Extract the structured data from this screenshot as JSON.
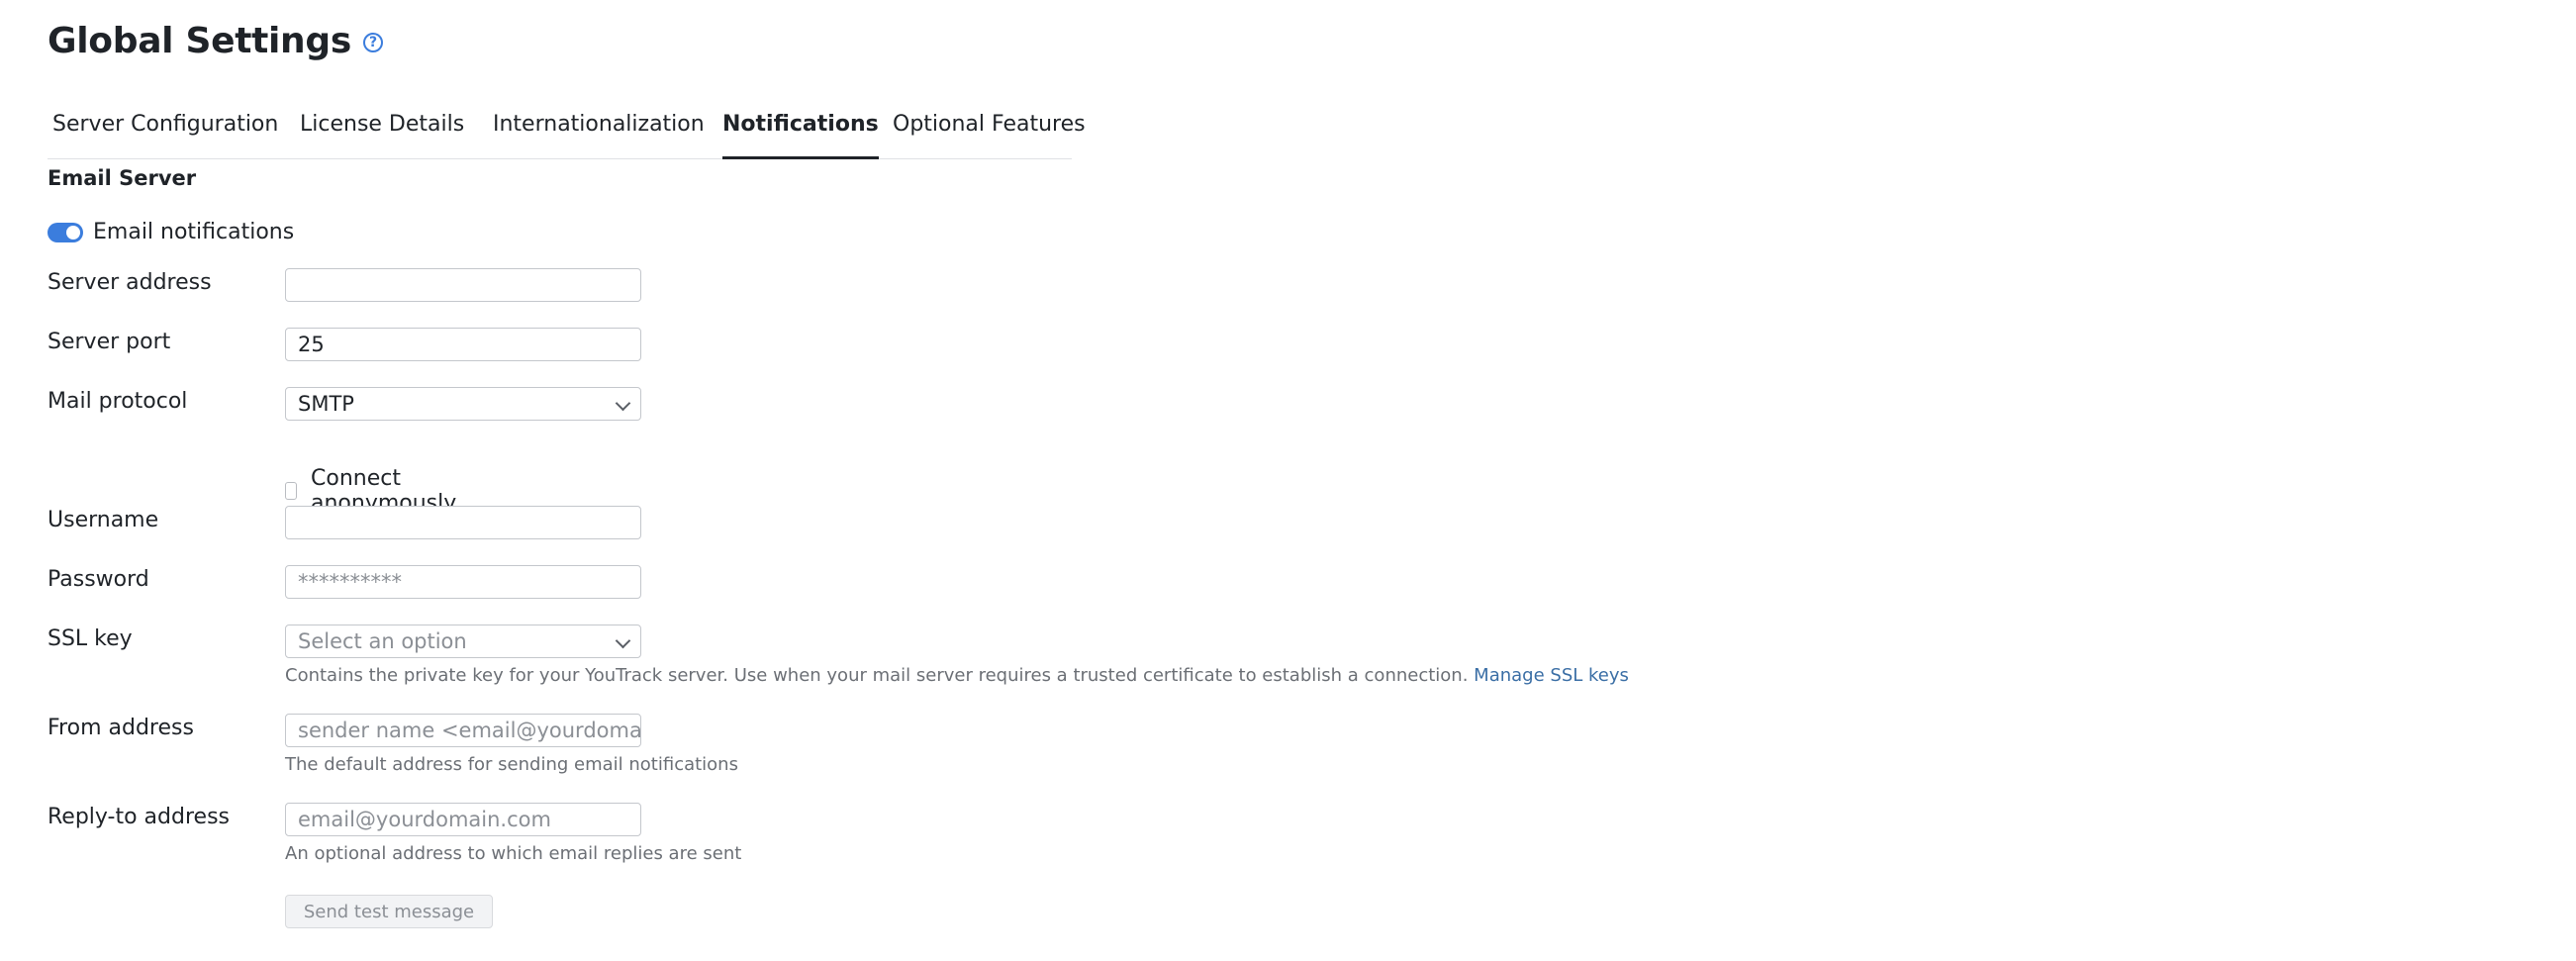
{
  "header": {
    "title": "Global Settings",
    "help_icon": "question-circle-icon",
    "help_glyph": "?"
  },
  "tabs": [
    {
      "label": "Server Configuration",
      "active": false
    },
    {
      "label": "License Details",
      "active": false
    },
    {
      "label": "Internationalization",
      "active": false
    },
    {
      "label": "Notifications",
      "active": true
    },
    {
      "label": "Optional Features",
      "active": false
    }
  ],
  "section": {
    "title": "Email Server"
  },
  "email_notifications": {
    "label": "Email notifications",
    "enabled": true
  },
  "form": {
    "server_address": {
      "label": "Server address",
      "value": ""
    },
    "server_port": {
      "label": "Server port",
      "value": "25"
    },
    "mail_protocol": {
      "label": "Mail protocol",
      "value": "SMTP"
    },
    "connect_anonymously": {
      "label": "Connect anonymously",
      "checked": false
    },
    "username": {
      "label": "Username",
      "value": ""
    },
    "password": {
      "label": "Password",
      "placeholder": "**********"
    },
    "ssl_key": {
      "label": "SSL key",
      "placeholder": "Select an option",
      "hint": "Contains the private key for your YouTrack server. Use when your mail server requires a trusted certificate to establish a connection.",
      "link": "Manage SSL keys"
    },
    "from_address": {
      "label": "From address",
      "placeholder": "sender name <email@yourdomain",
      "hint": "The default address for sending email notifications"
    },
    "reply_to_address": {
      "label": "Reply-to address",
      "placeholder": "email@yourdomain.com",
      "hint": "An optional address to which email replies are sent"
    }
  },
  "actions": {
    "send_test_label": "Send test message"
  },
  "colors": {
    "accent": "#3b7ddd",
    "text": "#1f2328",
    "hint": "#6b6f75",
    "link": "#3a6ea5"
  }
}
